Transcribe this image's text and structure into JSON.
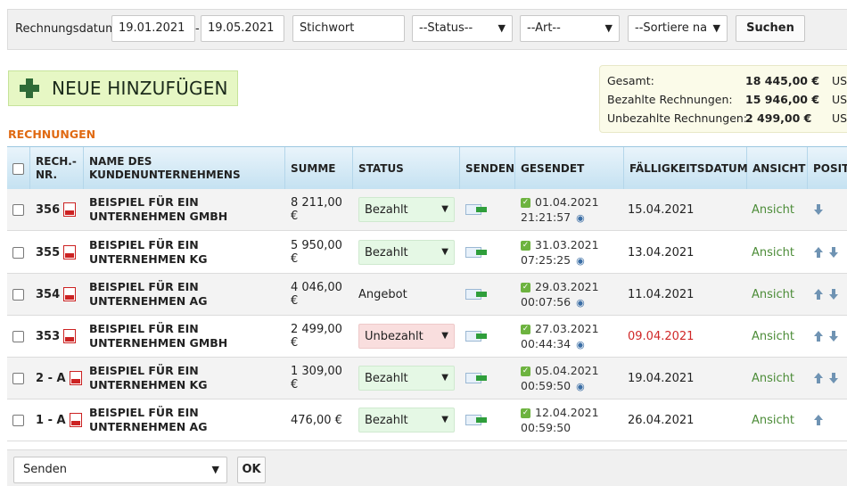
{
  "filters": {
    "date_label": "Rechnungsdatum:",
    "date_from": "19.01.2021",
    "date_sep": "-",
    "date_to": "19.05.2021",
    "keyword": "Stichwort",
    "status": "--Status--",
    "type": "--Art--",
    "sort": "--Sortiere na",
    "search_label": "Suchen"
  },
  "add_button": {
    "label": "NEUE HINZUFÜGEN",
    "icon": "plus-icon"
  },
  "summary": {
    "total_label": "Gesamt:",
    "total_value": "18 445,00 €",
    "total_currency": "US",
    "paid_label": "Bezahlte Rechnungen:",
    "paid_value": "15 946,00 €",
    "paid_currency": "US",
    "unpaid_label": "Unbezahlte Rechnungen:",
    "unpaid_value": "2 499,00 €",
    "unpaid_currency": "US"
  },
  "section_title": "RECHNUNGEN",
  "table": {
    "headers": {
      "nr": "RECH.-\nNR.",
      "company": "NAME DES\nKUNDENUNTERNEHMENS",
      "sum": "SUMME",
      "status": "STATUS",
      "send": "SENDEN",
      "sent": "GESENDET",
      "due": "FÄLLIGKEITSDATUM",
      "view": "ANSICHT",
      "pos": "POSIT"
    },
    "rows": [
      {
        "nr": "356",
        "company": "BEISPIEL FÜR EIN UNTERNEHMEN GMBH",
        "sum": "8 211,00 €",
        "status": "Bezahlt",
        "sent_date": "01.04.2021",
        "sent_time": "21:21:57",
        "due": "15.04.2021",
        "view": "Ansicht"
      },
      {
        "nr": "355",
        "company": "BEISPIEL FÜR EIN UNTERNEHMEN KG",
        "sum": "5 950,00 €",
        "status": "Bezahlt",
        "sent_date": "31.03.2021",
        "sent_time": "07:25:25",
        "due": "13.04.2021",
        "view": "Ansicht"
      },
      {
        "nr": "354",
        "company": "BEISPIEL FÜR EIN UNTERNEHMEN AG",
        "sum": "4 046,00 €",
        "status": "Angebot",
        "sent_date": "29.03.2021",
        "sent_time": "00:07:56",
        "due": "11.04.2021",
        "view": "Ansicht"
      },
      {
        "nr": "353",
        "company": "BEISPIEL FÜR EIN UNTERNEHMEN GMBH",
        "sum": "2 499,00 €",
        "status": "Unbezahlt",
        "sent_date": "27.03.2021",
        "sent_time": "00:44:34",
        "due": "09.04.2021",
        "view": "Ansicht"
      },
      {
        "nr": "2 - A",
        "company": "BEISPIEL FÜR EIN UNTERNEHMEN KG",
        "sum": "1 309,00 €",
        "status": "Bezahlt",
        "sent_date": "05.04.2021",
        "sent_time": "00:59:50",
        "due": "19.04.2021",
        "view": "Ansicht"
      },
      {
        "nr": "1 - A",
        "company": "BEISPIEL FÜR EIN UNTERNEHMEN AG",
        "sum": "476,00 €",
        "status": "Bezahlt",
        "sent_date": "12.04.2021",
        "sent_time": "00:59:50",
        "due": "26.04.2021",
        "view": "Ansicht"
      }
    ]
  },
  "bulk": {
    "action": "Senden",
    "ok_label": "OK"
  },
  "colors": {
    "accent_orange": "#e06a13",
    "overdue_red": "#d02828",
    "link_green": "#4c8c38",
    "paid_bg": "#e5f8e5",
    "unpaid_bg": "#f9dede"
  }
}
